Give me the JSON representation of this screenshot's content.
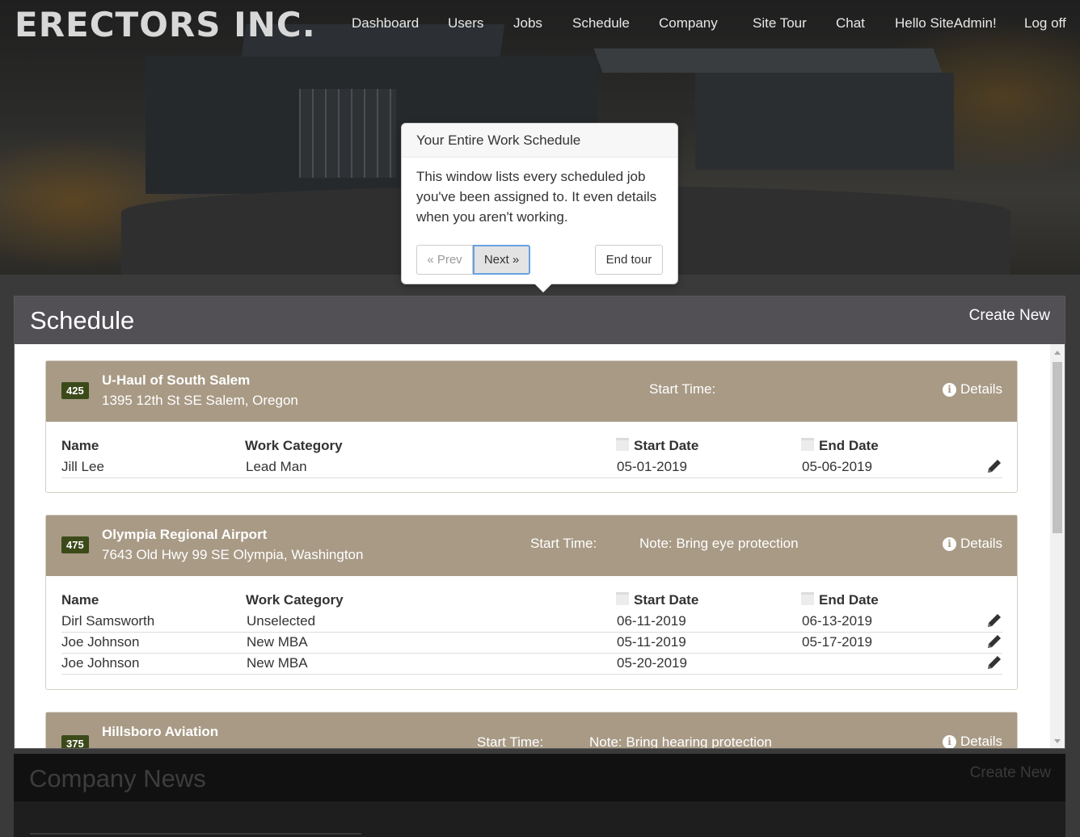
{
  "brand": "ERECTORS INC.",
  "nav": [
    "Dashboard",
    "Users",
    "Jobs",
    "Schedule",
    "Company",
    "Site Tour",
    "Chat",
    "Hello SiteAdmin!",
    "Log off"
  ],
  "tour": {
    "title": "Your Entire Work Schedule",
    "body": "This window lists every scheduled job you've been assigned to. It even details when you aren't working.",
    "prev": "« Prev",
    "next": "Next »",
    "end": "End tour"
  },
  "schedule": {
    "title": "Schedule",
    "create_new": "Create New",
    "columns": {
      "name": "Name",
      "category": "Work Category",
      "start": "Start Date",
      "end": "End Date"
    },
    "start_time_label": "Start Time:",
    "details_label": "Details",
    "jobs": [
      {
        "number": "425",
        "name": "U-Haul of South Salem",
        "address": "1395 12th St SE Salem, Oregon",
        "note": "",
        "rows": [
          {
            "name": "Jill Lee",
            "category": "Lead Man",
            "start": "05-01-2019",
            "end": "05-06-2019"
          }
        ]
      },
      {
        "number": "475",
        "name": "Olympia Regional Airport",
        "address": "7643 Old Hwy 99 SE Olympia, Washington",
        "note": "Note: Bring eye protection",
        "rows": [
          {
            "name": "Dirl Samsworth",
            "category": "Unselected",
            "start": "06-11-2019",
            "end": "06-13-2019"
          },
          {
            "name": "Joe Johnson",
            "category": "New MBA",
            "start": "05-11-2019",
            "end": "05-17-2019"
          },
          {
            "name": "Joe Johnson",
            "category": "New MBA",
            "start": "05-20-2019",
            "end": ""
          }
        ]
      },
      {
        "number": "375",
        "name": "Hillsboro Aviation",
        "address": "",
        "note": "Note: Bring hearing protection",
        "rows": []
      }
    ]
  },
  "news": {
    "title": "Company News",
    "create_new": "Create New"
  }
}
